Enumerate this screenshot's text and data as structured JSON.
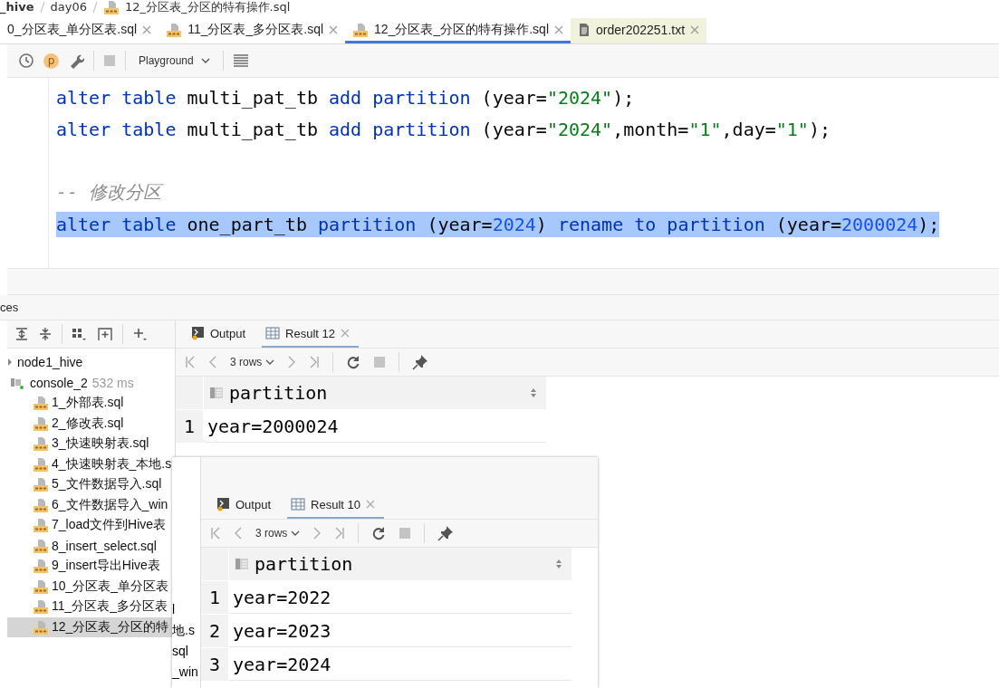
{
  "breadcrumb": [
    "_hive",
    "day06",
    "12_分区表_分区的特有操作.sql"
  ],
  "tabs": [
    {
      "label": "0_分区表_单分区表.sql",
      "kind": "none",
      "selected": false
    },
    {
      "label": "11_分区表_多分区表.sql",
      "kind": "sql",
      "selected": false
    },
    {
      "label": "12_分区表_分区的特有操作.sql",
      "kind": "sql",
      "selected": true
    },
    {
      "label": "order202251.txt",
      "kind": "txt",
      "selected": false
    }
  ],
  "toolbar": {
    "badge": "p",
    "session": "Playground"
  },
  "editor": {
    "lines": [
      {
        "kind": "code",
        "selected": false,
        "tokens": [
          {
            "kind": "kw",
            "text": "alter table"
          },
          {
            "kind": "plain",
            "text": " multi_pat_tb "
          },
          {
            "kind": "kw",
            "text": "add partition"
          },
          {
            "kind": "plain",
            "text": " (year="
          },
          {
            "kind": "str",
            "text": "\"2024\""
          },
          {
            "kind": "plain",
            "text": ");"
          }
        ]
      },
      {
        "kind": "code",
        "selected": false,
        "tokens": [
          {
            "kind": "kw",
            "text": "alter table"
          },
          {
            "kind": "plain",
            "text": " multi_pat_tb "
          },
          {
            "kind": "kw",
            "text": "add partition"
          },
          {
            "kind": "plain",
            "text": " (year="
          },
          {
            "kind": "str",
            "text": "\"2024\""
          },
          {
            "kind": "plain",
            "text": ",month="
          },
          {
            "kind": "str",
            "text": "\"1\""
          },
          {
            "kind": "plain",
            "text": ",day="
          },
          {
            "kind": "str",
            "text": "\"1\""
          },
          {
            "kind": "plain",
            "text": ");"
          }
        ]
      },
      {
        "kind": "blank"
      },
      {
        "kind": "code",
        "selected": false,
        "tokens": [
          {
            "kind": "comment",
            "text": "-- 修改分区"
          }
        ]
      },
      {
        "kind": "code",
        "selected": true,
        "tokens": [
          {
            "kind": "kw",
            "text": "alter table"
          },
          {
            "kind": "plain",
            "text": " one_part_tb "
          },
          {
            "kind": "kw",
            "text": "partition"
          },
          {
            "kind": "plain",
            "text": " (year="
          },
          {
            "kind": "num",
            "text": "2024"
          },
          {
            "kind": "plain",
            "text": ") "
          },
          {
            "kind": "kw",
            "text": "rename to partition"
          },
          {
            "kind": "plain",
            "text": " (year="
          },
          {
            "kind": "num",
            "text": "2000024"
          },
          {
            "kind": "plain",
            "text": ");"
          }
        ]
      }
    ]
  },
  "services_title": "ces",
  "tree": {
    "root": "node1_hive",
    "console": {
      "name": "console_2",
      "time": "532 ms"
    },
    "files": [
      {
        "name": "1_外部表.sql",
        "selected": false
      },
      {
        "name": "2_修改表.sql",
        "selected": false
      },
      {
        "name": "3_快速映射表.sql",
        "selected": false
      },
      {
        "name": "4_快速映射表_本地.s",
        "selected": false
      },
      {
        "name": "5_文件数据导入.sql",
        "selected": false
      },
      {
        "name": "6_文件数据导入_win",
        "selected": false
      },
      {
        "name": "7_load文件到Hive表",
        "selected": false
      },
      {
        "name": "8_insert_select.sql",
        "selected": false
      },
      {
        "name": "9_insert导出Hive表",
        "selected": false
      },
      {
        "name": "10_分区表_单分区表",
        "selected": false
      },
      {
        "name": "11_分区表_多分区表",
        "selected": false
      },
      {
        "name": "12_分区表_分区的特",
        "selected": true
      }
    ]
  },
  "results": [
    {
      "output_tab": "Output",
      "result_tab": "Result 12",
      "rows_label": "3 rows",
      "column": "partition",
      "rows": [
        {
          "index": "1",
          "value": "year=2000024"
        }
      ]
    },
    {
      "output_tab": "Output",
      "result_tab": "Result 10",
      "rows_label": "3 rows",
      "column": "partition",
      "rows": [
        {
          "index": "1",
          "value": "year=2022"
        },
        {
          "index": "2",
          "value": "year=2023"
        },
        {
          "index": "3",
          "value": "year=2024"
        }
      ],
      "edge_texts": [
        "l",
        "地.s",
        "sql",
        "_win"
      ]
    }
  ]
}
